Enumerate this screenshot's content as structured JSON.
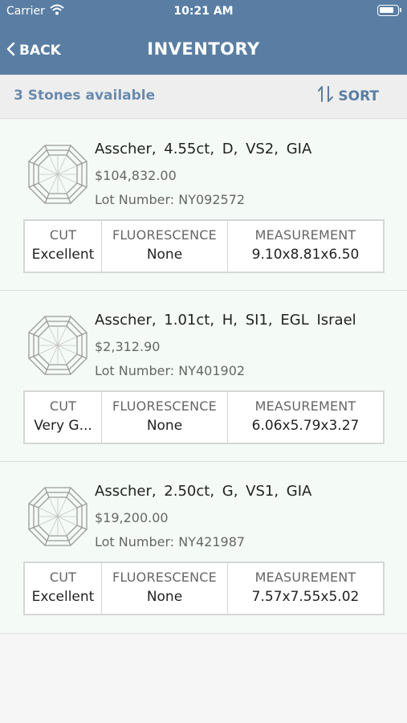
{
  "status_bar": {
    "carrier": "Carrier",
    "time": "10:21 AM"
  },
  "nav": {
    "back_label": "BACK",
    "title": "INVENTORY"
  },
  "toolbar": {
    "count_label": "3 Stones available",
    "sort_label": "SORT"
  },
  "spec_headers": {
    "cut": "CUT",
    "fluorescence": "FLUORESCENCE",
    "measurement": "MEASUREMENT"
  },
  "stones": [
    {
      "name": "Asscher, 4.55ct, D, VS2, GIA",
      "price": "$104,832.00",
      "lot": "Lot Number: NY092572",
      "cut": "Excellent",
      "fluorescence": "None",
      "measurement": "9.10x8.81x6.50"
    },
    {
      "name": "Asscher, 1.01ct, H, SI1, EGL Israel",
      "price": "$2,312.90",
      "lot": "Lot Number: NY401902",
      "cut": "Very G...",
      "fluorescence": "None",
      "measurement": "6.06x5.79x3.27"
    },
    {
      "name": "Asscher, 2.50ct, G, VS1, GIA",
      "price": "$19,200.00",
      "lot": "Lot Number: NY421987",
      "cut": "Excellent",
      "fluorescence": "None",
      "measurement": "7.57x7.55x5.02"
    }
  ],
  "colors": {
    "nav_background": "#5a7ea3",
    "card_background": "#f4fbf6",
    "accent": "#5a7ea3"
  },
  "icons": {
    "back": "chevron-left-icon",
    "sort": "sort-icon",
    "stone": "asscher-diamond-icon"
  }
}
